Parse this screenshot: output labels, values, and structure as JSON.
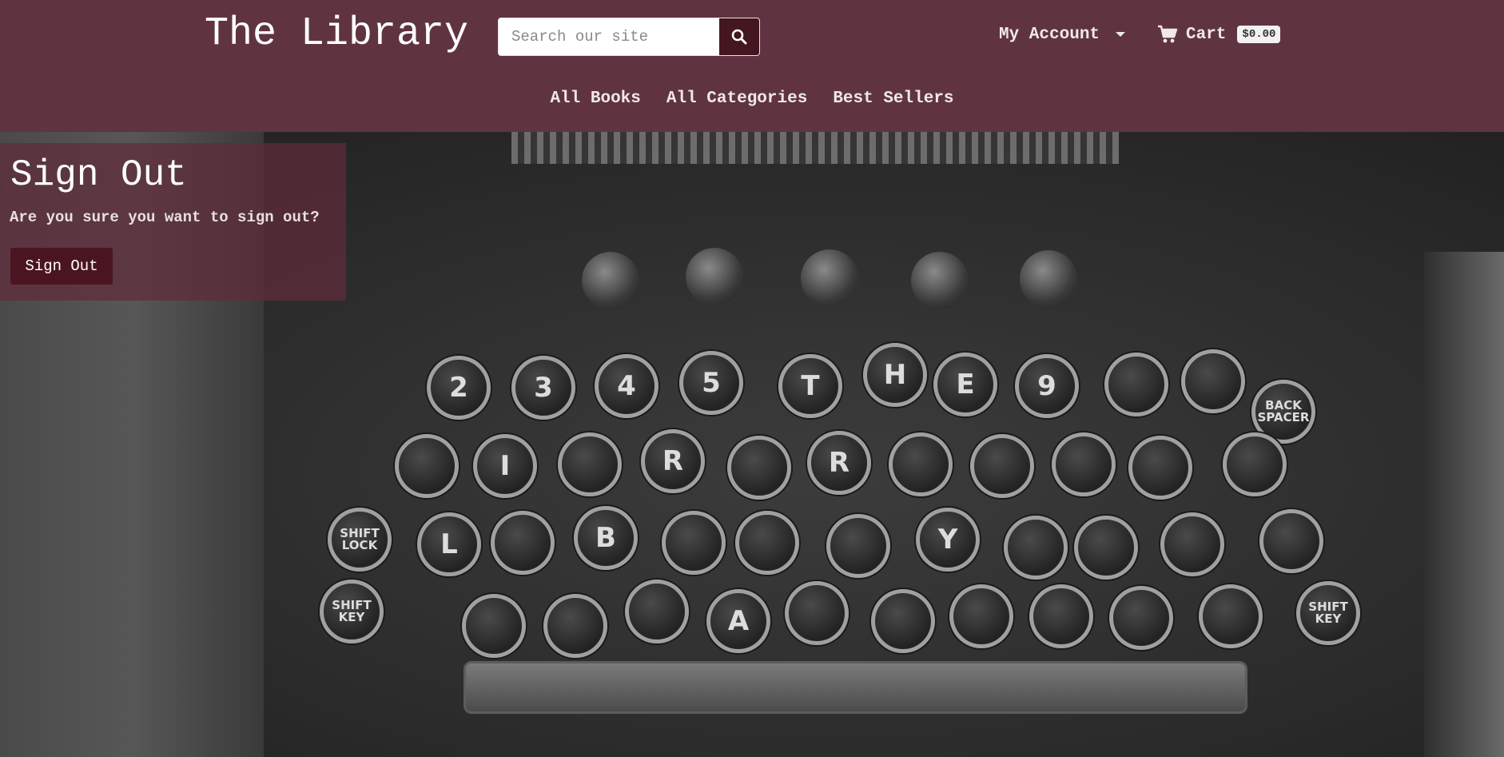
{
  "header": {
    "brand": "The Library",
    "search": {
      "placeholder": "Search our site",
      "value": "",
      "icon": "search-icon"
    },
    "account_label": "My Account",
    "cart_label": "Cart",
    "cart_total": "$0.00"
  },
  "nav": {
    "items": [
      {
        "label": "All Books"
      },
      {
        "label": "All Categories"
      },
      {
        "label": "Best Sellers"
      }
    ]
  },
  "signout": {
    "title": "Sign Out",
    "message": "Are you sure you want to sign out?",
    "button_label": "Sign Out"
  },
  "hero": {
    "keys": [
      "2",
      "3",
      "4",
      "5",
      "T",
      "H",
      "E",
      "9",
      "I",
      "R",
      "R",
      "L",
      "B",
      "Y",
      "A",
      "SHIFT LOCK",
      "SHIFT KEY",
      "BACK SPACER"
    ]
  },
  "colors": {
    "header_bg": "#5f3440",
    "button_dark": "#4a1521",
    "panel_overlay": "#5f2d3a"
  }
}
